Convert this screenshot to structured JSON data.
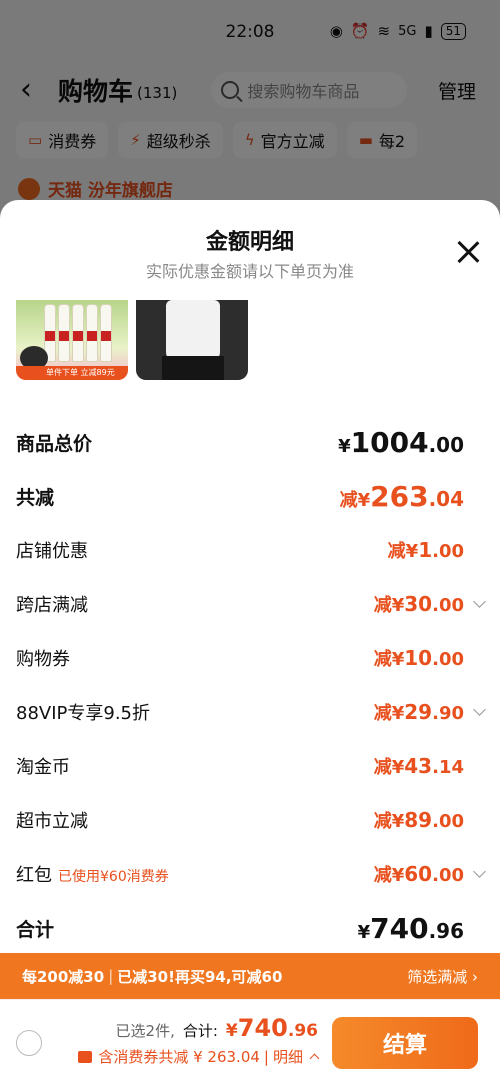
{
  "status_bar": {
    "time": "22:08",
    "network": "5G",
    "battery": "51"
  },
  "header": {
    "title": "购物车",
    "count": "(131)",
    "search_placeholder": "搜索购物车商品",
    "manage": "管理"
  },
  "chips": [
    "消费券",
    "超级秒杀",
    "官方立减",
    "每2"
  ],
  "store_hint": "天猫  汾年旗舰店",
  "sheet": {
    "title": "金额明细",
    "subtitle": "实际优惠金额请以下单页为准",
    "thumb_tag": "单件下单 立减89元"
  },
  "rows": [
    {
      "label": "商品总价",
      "prefix": "¥",
      "num": "1004",
      "dec": ".00"
    },
    {
      "label": "共减",
      "prefix": "减¥",
      "num": "263",
      "dec": ".04"
    },
    {
      "label": "店铺优惠",
      "prefix": "减¥",
      "num": "1",
      "dec": ".00"
    },
    {
      "label": "跨店满减",
      "prefix": "减¥",
      "num": "30",
      "dec": ".00"
    },
    {
      "label": "购物券",
      "prefix": "减¥",
      "num": "10",
      "dec": ".00"
    },
    {
      "label": "88VIP专享9.5折",
      "prefix": "减¥",
      "num": "29",
      "dec": ".90"
    },
    {
      "label": "淘金币",
      "prefix": "减¥",
      "num": "43",
      "dec": ".14"
    },
    {
      "label": "超市立减",
      "prefix": "减¥",
      "num": "89",
      "dec": ".00"
    },
    {
      "label": "红包",
      "note": "已使用¥60消费券",
      "prefix": "减¥",
      "num": "60",
      "dec": ".00"
    },
    {
      "label": "合计",
      "prefix": "¥",
      "num": "740",
      "dec": ".96"
    }
  ],
  "promo": {
    "part1": "每200减30",
    "part2": "已减30!再买94,可减60",
    "link": "筛选满减 ›"
  },
  "bottom": {
    "selected": "已选2件,",
    "total_label": "合计:",
    "total_sym": "¥",
    "total_num": "740",
    "total_dec": ".96",
    "discount_text": "含消费券共减 ¥ 263.04",
    "detail": "明细",
    "checkout": "结算"
  },
  "colors": {
    "accent": "#e8501e",
    "promo_bg": "#f0761f"
  }
}
